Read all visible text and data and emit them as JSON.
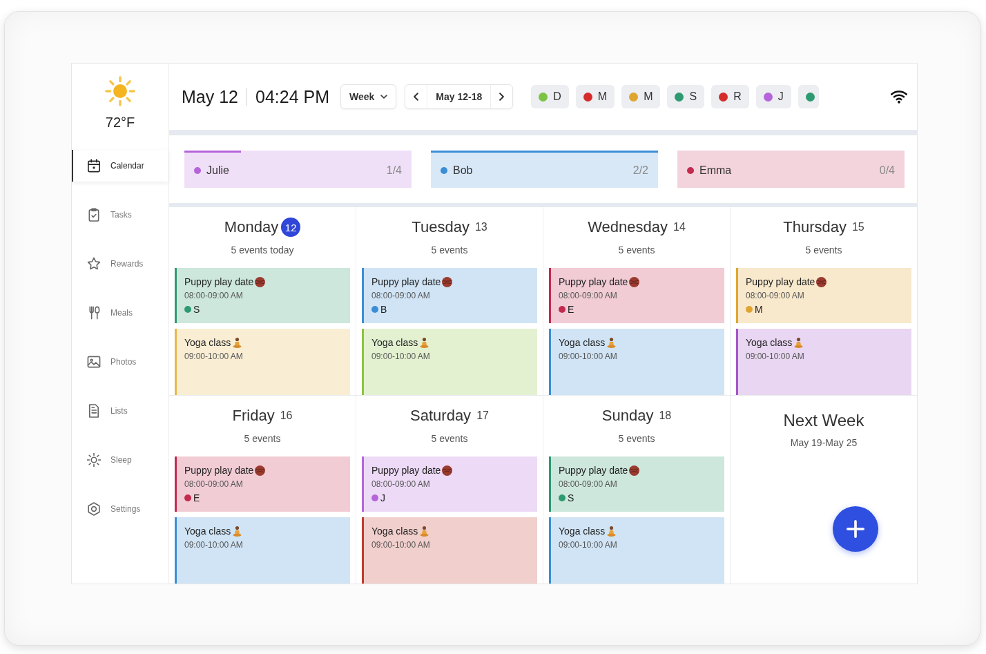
{
  "sidebar": {
    "weather": {
      "temperature": "72°F"
    },
    "items": [
      {
        "kind": "calendar",
        "label": "Calendar",
        "selected": true
      },
      {
        "kind": "tasks",
        "label": "Tasks",
        "selected": false
      },
      {
        "kind": "rewards",
        "label": "Rewards",
        "selected": false
      },
      {
        "kind": "meals",
        "label": "Meals",
        "selected": false
      },
      {
        "kind": "photos",
        "label": "Photos",
        "selected": false
      },
      {
        "kind": "lists",
        "label": "Lists",
        "selected": false
      },
      {
        "kind": "sleep",
        "label": "Sleep",
        "selected": false
      },
      {
        "kind": "settings",
        "label": "Settings",
        "selected": false
      }
    ]
  },
  "header": {
    "date": "May 12",
    "time": "04:24 PM",
    "view": "Week",
    "range": "May 12-18"
  },
  "family": [
    {
      "initial": "D",
      "color": "#7cc243"
    },
    {
      "initial": "M",
      "color": "#d62b2b"
    },
    {
      "initial": "M",
      "color": "#e0a530"
    },
    {
      "initial": "S",
      "color": "#2e9a72"
    },
    {
      "initial": "R",
      "color": "#d62b2b"
    },
    {
      "initial": "J",
      "color": "#b565d9"
    },
    {
      "color": "#2e9a72"
    }
  ],
  "people": [
    {
      "name": "Julie",
      "count": "1/4",
      "level": 0.25,
      "color": "#b565d9"
    },
    {
      "name": "Bob",
      "count": "2/2",
      "level": 1,
      "color": "#3b8ed6"
    },
    {
      "name": "Emma",
      "count": "0/4",
      "level": 0,
      "color": "#c42a4e"
    }
  ],
  "days": [
    {
      "name": "Monday",
      "number": "12",
      "today": true,
      "summary": "5 events today",
      "events": [
        {
          "kind": "playdate",
          "title": "Puppy play date",
          "time": "08:00-09:00 AM",
          "color": "#2e9a72",
          "person": {
            "initial": "S",
            "color": "#2e9a72"
          }
        },
        {
          "kind": "yoga",
          "title": "Yoga class",
          "time": "09:00-10:00 AM",
          "color": "#e8b84a"
        }
      ]
    },
    {
      "name": "Tuesday",
      "number": "13",
      "today": false,
      "summary": "5 events",
      "events": [
        {
          "kind": "playdate",
          "title": "Puppy play date",
          "time": "08:00-09:00 AM",
          "color": "#3b8ed6",
          "person": {
            "initial": "B",
            "color": "#3b8ed6"
          }
        },
        {
          "kind": "yoga",
          "title": "Yoga class",
          "time": "09:00-10:00 AM",
          "color": "#8cc43c"
        }
      ]
    },
    {
      "name": "Wednesday",
      "number": "14",
      "today": false,
      "summary": "5 events",
      "events": [
        {
          "kind": "playdate",
          "title": "Puppy play date",
          "time": "08:00-09:00 AM",
          "color": "#c42a4e",
          "person": {
            "initial": "E",
            "color": "#c42a4e"
          }
        },
        {
          "kind": "yoga",
          "title": "Yoga class",
          "time": "09:00-10:00 AM",
          "color": "#3b8ed6"
        }
      ]
    },
    {
      "name": "Thursday",
      "number": "15",
      "today": false,
      "summary": "5 events",
      "events": [
        {
          "kind": "playdate",
          "title": "Puppy play date",
          "time": "08:00-09:00 AM",
          "color": "#e0a530",
          "person": {
            "initial": "M",
            "color": "#e0a530"
          }
        },
        {
          "kind": "yoga",
          "title": "Yoga class",
          "time": "09:00-10:00 AM",
          "color": "#a555c9"
        }
      ]
    },
    {
      "name": "Friday",
      "number": "16",
      "today": false,
      "summary": "5 events",
      "events": [
        {
          "kind": "playdate",
          "title": "Puppy play date",
          "time": "08:00-09:00 AM",
          "color": "#c42a4e",
          "person": {
            "initial": "E",
            "color": "#c42a4e"
          }
        },
        {
          "kind": "yoga",
          "title": "Yoga class",
          "time": "09:00-10:00 AM",
          "color": "#3b8ed6"
        }
      ]
    },
    {
      "name": "Saturday",
      "number": "17",
      "today": false,
      "summary": "5 events",
      "events": [
        {
          "kind": "playdate",
          "title": "Puppy play date",
          "time": "08:00-09:00 AM",
          "color": "#b565d9",
          "person": {
            "initial": "J",
            "color": "#b565d9"
          }
        },
        {
          "kind": "yoga",
          "title": "Yoga class",
          "time": "09:00-10:00 AM",
          "color": "#c0392b"
        }
      ]
    },
    {
      "name": "Sunday",
      "number": "18",
      "today": false,
      "summary": "5 events",
      "events": [
        {
          "kind": "playdate",
          "title": "Puppy play date",
          "time": "08:00-09:00 AM",
          "color": "#2e9a72",
          "person": {
            "initial": "S",
            "color": "#2e9a72"
          }
        },
        {
          "kind": "yoga",
          "title": "Yoga class",
          "time": "09:00-10:00 AM",
          "color": "#3b8ed6"
        }
      ]
    }
  ],
  "next_week": {
    "title": "Next Week",
    "range": "May 19-May 25"
  }
}
